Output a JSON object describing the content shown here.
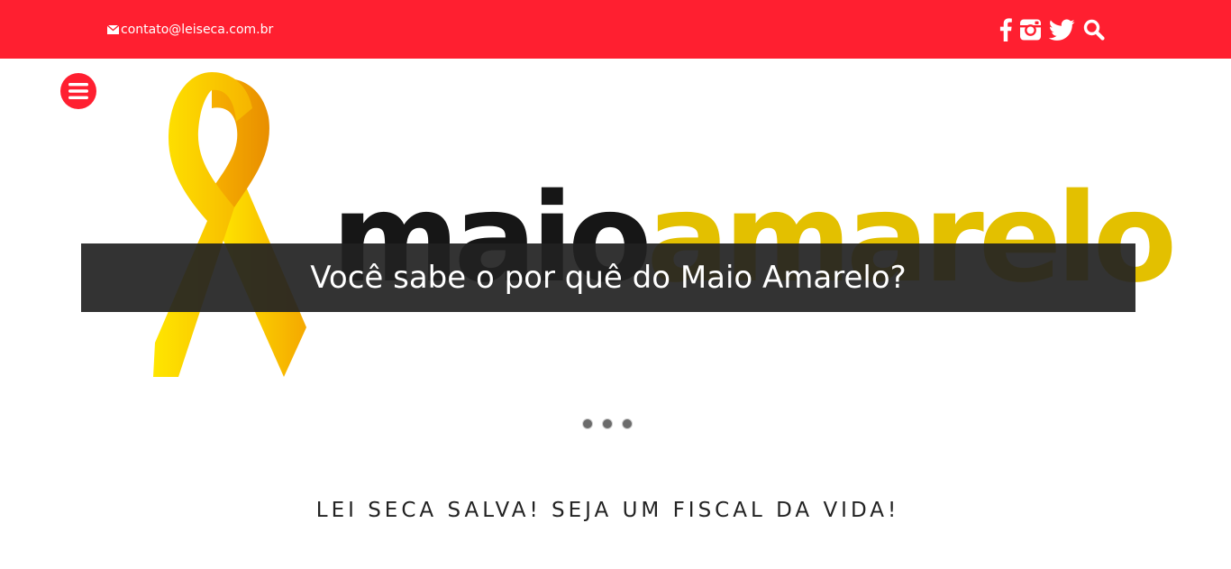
{
  "header": {
    "email": "contato@leiseca.com.br",
    "icons": [
      "facebook-icon",
      "instagram-icon",
      "twitter-icon",
      "search-icon"
    ]
  },
  "hero": {
    "brand_word1": "maio",
    "brand_word2": "amarelo",
    "caption": "Você sabe o por quê do Maio Amarelo?",
    "slide_count": 3
  },
  "tagline": "LEI SECA SALVA! SEJA UM FISCAL DA VIDA!",
  "colors": {
    "primary_red": "#ff1f30",
    "ribbon_yellow": "#f5d400",
    "brand_dark": "#161616",
    "brand_yellow": "#e3c000",
    "caption_bg": "#222222"
  }
}
